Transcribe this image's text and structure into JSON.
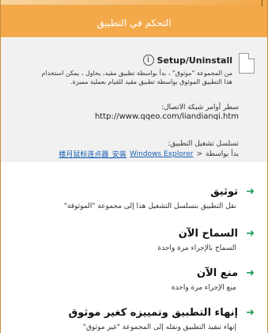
{
  "window": {
    "title": "التحكم في التطبيق"
  },
  "app": {
    "name": "Setup/Uninstall",
    "description": "من المجموعة \"موثوق\" ، بدأ بواسطة تطبيق مقيد، يحاول ، يمكن استخدام هذا التطبيق الموثوق بواسطة تطبيق مقيد للقيام بعملية مميزة."
  },
  "cmdline": {
    "label": "سطر أوامر شبكة الاتصال:",
    "value": "http://www.qqeo.com/liandianqi.htm"
  },
  "chain": {
    "label": "تسلسل تشغيل التطبيق:",
    "started_by": "بدأ بواسطة",
    "sep": "<",
    "item1": "Windows Explorer",
    "item2": "楼月鼠标连点器_安装"
  },
  "actions": [
    {
      "name": "توثيق",
      "desc": "نقل التطبيق بتسلسل التشغيل هذا إلى مجموعة \"الموثوقة\""
    },
    {
      "name": "السماح الآن",
      "desc": "السماح بالإجراء مرة واحدة"
    },
    {
      "name": "منع الآن",
      "desc": "منع الإجراء مرة واحدة"
    },
    {
      "name": "إنهاء التطبيق وتمييزه كغير موثوق",
      "desc": "إنهاء تنفيذ التطبيق ونقله إلى المجموعة \"غير موثوق\""
    }
  ],
  "icons": {
    "arrow": "green-arrow-icon",
    "info": "info-icon",
    "doc": "document-icon"
  },
  "colors": {
    "title_bg": "#f3a94a",
    "arrow": "#1f9d55",
    "link": "#1a5fb4"
  }
}
